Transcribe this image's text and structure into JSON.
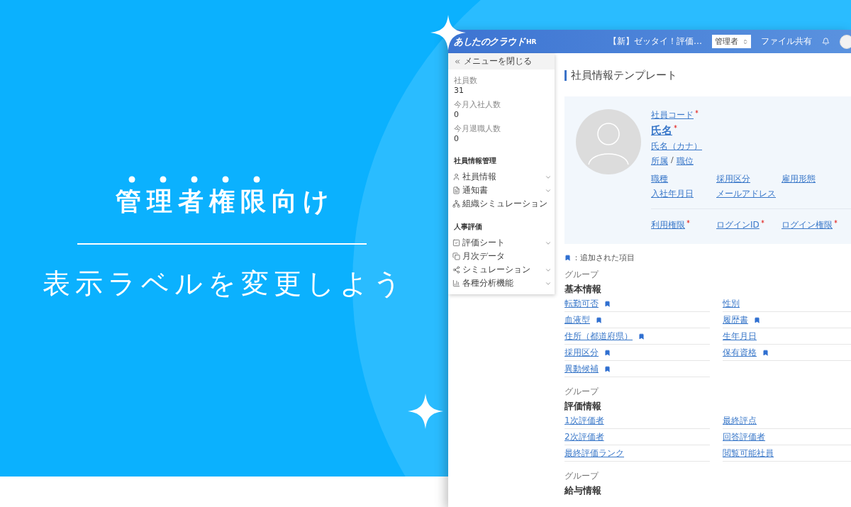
{
  "hero": {
    "headline": "管理者権限向け",
    "subline": "表示ラベルを変更しよう"
  },
  "app": {
    "header": {
      "logo": "あしたのクラウド",
      "logo_suffix": "HR",
      "notice": "【新】ゼッタイ！評価…",
      "role_select": {
        "value": "管理者"
      },
      "file_share": "ファイル共有"
    },
    "sidebar": {
      "close_menu": "メニューを閉じる",
      "stats": [
        {
          "label": "社員数",
          "value": "31"
        },
        {
          "label": "今月入社人数",
          "value": "0"
        },
        {
          "label": "今月退職人数",
          "value": "0"
        }
      ],
      "sections": [
        {
          "title": "社員情報管理",
          "items": [
            {
              "label": "社員情報",
              "kind": "person",
              "expandable": true
            },
            {
              "label": "通知書",
              "kind": "document",
              "expandable": true
            },
            {
              "label": "組織シミュレーション",
              "kind": "org",
              "expandable": false
            }
          ]
        },
        {
          "title": "人事評価",
          "items": [
            {
              "label": "評価シート",
              "kind": "check",
              "expandable": true
            },
            {
              "label": "月次データ",
              "kind": "copy",
              "expandable": false
            },
            {
              "label": "シミュレーション",
              "kind": "nodes",
              "expandable": true
            },
            {
              "label": "各種分析機能",
              "kind": "chart",
              "expandable": true
            }
          ]
        }
      ]
    },
    "main": {
      "title": "社員情報テンプレート",
      "profile": {
        "code": {
          "label": "社員コード",
          "required": true
        },
        "name": {
          "label": "氏名",
          "required": true
        },
        "kana": {
          "label": "氏名（カナ）",
          "required": false
        },
        "affiliation": "所属",
        "separator": "/",
        "position": "職位",
        "details": [
          {
            "label": "職種",
            "required": false
          },
          {
            "label": "採用区分",
            "required": false
          },
          {
            "label": "雇用形態",
            "required": false
          },
          {
            "label": "入社年月日",
            "required": false
          },
          {
            "label": "メールアドレス",
            "required": false
          }
        ],
        "account": [
          {
            "label": "利用権限",
            "required": true
          },
          {
            "label": "ログインID",
            "required": true
          },
          {
            "label": "ログイン権限",
            "required": true
          }
        ]
      },
      "legend": "：追加された項目",
      "groups": [
        {
          "caption": "グループ",
          "title": "基本情報",
          "fields": [
            {
              "label": "転勤可否",
              "added": true
            },
            {
              "label": "性別",
              "added": false
            },
            {
              "label": "血液型",
              "added": true
            },
            {
              "label": "履歴書",
              "added": true
            },
            {
              "label": "住所（都道府県）",
              "added": true
            },
            {
              "label": "生年月日",
              "added": false
            },
            {
              "label": "採用区分",
              "added": true
            },
            {
              "label": "保有資格",
              "added": true
            },
            {
              "label": "異動候補",
              "added": true
            }
          ]
        },
        {
          "caption": "グループ",
          "title": "評価情報",
          "fields": [
            {
              "label": "1次評価者",
              "added": false
            },
            {
              "label": "最終評点",
              "added": false
            },
            {
              "label": "2次評価者",
              "added": false
            },
            {
              "label": "回答評価者",
              "added": false
            },
            {
              "label": "最終評価ランク",
              "added": false
            },
            {
              "label": "閲覧可能社員",
              "added": false
            }
          ]
        },
        {
          "caption": "グループ",
          "title": "給与情報"
        }
      ]
    }
  }
}
